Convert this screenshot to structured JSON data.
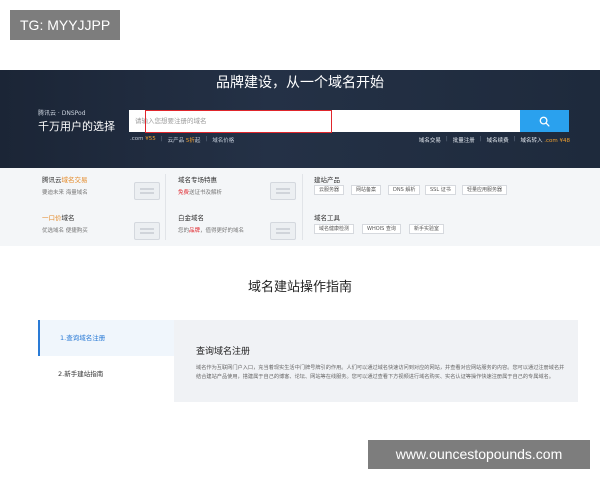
{
  "watermarks": {
    "tag": "TG: MYYJJPP",
    "url": "www.ouncestopounds.com"
  },
  "hero": {
    "title": "品牌建设，从一个域名开始",
    "brand_sub": "腾讯云 · DNSPod",
    "brand_main": "千万用户的选择",
    "search_placeholder": "请输入您想要注册的域名",
    "search_icon": "search-icon",
    "links_left": [
      {
        "text": ".com",
        "price": "¥55"
      },
      {
        "text": "云产品",
        "price": "5折",
        "suffix": "起"
      },
      {
        "text": "域名价格",
        "price": ""
      }
    ],
    "links_right": [
      {
        "text": "域名交易",
        "price": ""
      },
      {
        "text": "批量注册",
        "price": ""
      },
      {
        "text": "域名续费",
        "price": ""
      },
      {
        "text": "域名转入",
        "price": ".com ¥48"
      }
    ]
  },
  "panel": {
    "c1": {
      "t1_pre": "腾讯云",
      "t1_hl": "域名交易",
      "d1": "要迪未来 海量域名",
      "t2_pre": "一口价",
      "t2_hl": "域名",
      "t2_pre_hl": "一口价",
      "t2_rest": "域名",
      "d2": "优选域名 便捷购买"
    },
    "c2": {
      "t1": "域名专场特惠",
      "d1_hl": "免费",
      "d1_rest": "送证书及解析",
      "t2": "白金域名",
      "d2_pre": "您的",
      "d2_hl": "品牌",
      "d2_rest": "，值得更好的域名"
    },
    "c3": {
      "t1": "建站产品",
      "tags1": [
        "云服务器",
        "网站备案",
        "DNS 解析",
        "SSL 证书",
        "轻量应用服务器"
      ],
      "t2": "域名工具",
      "tags2": [
        "域名健康检测",
        "WHOIS 查询",
        "新手实验室"
      ]
    }
  },
  "guide": {
    "section_title": "域名建站操作指南",
    "items": [
      "1.查询域名注册",
      "2.新手建站指南"
    ],
    "heading": "查询域名注册",
    "body": "域名作为互联网门户入口，充当着现实生活中门牌号牌引的作用。人们可以通过域名快速访问到对应的网站，并查看对应网站服务的内容。您可以通过注册域名并结合建站产品使用，搭建属于自己的博客、论坛、网站等在线服务。您可以通过查看下方视频进行域名购买、实名认证等操作快速注册属于自己的专属域名。"
  }
}
